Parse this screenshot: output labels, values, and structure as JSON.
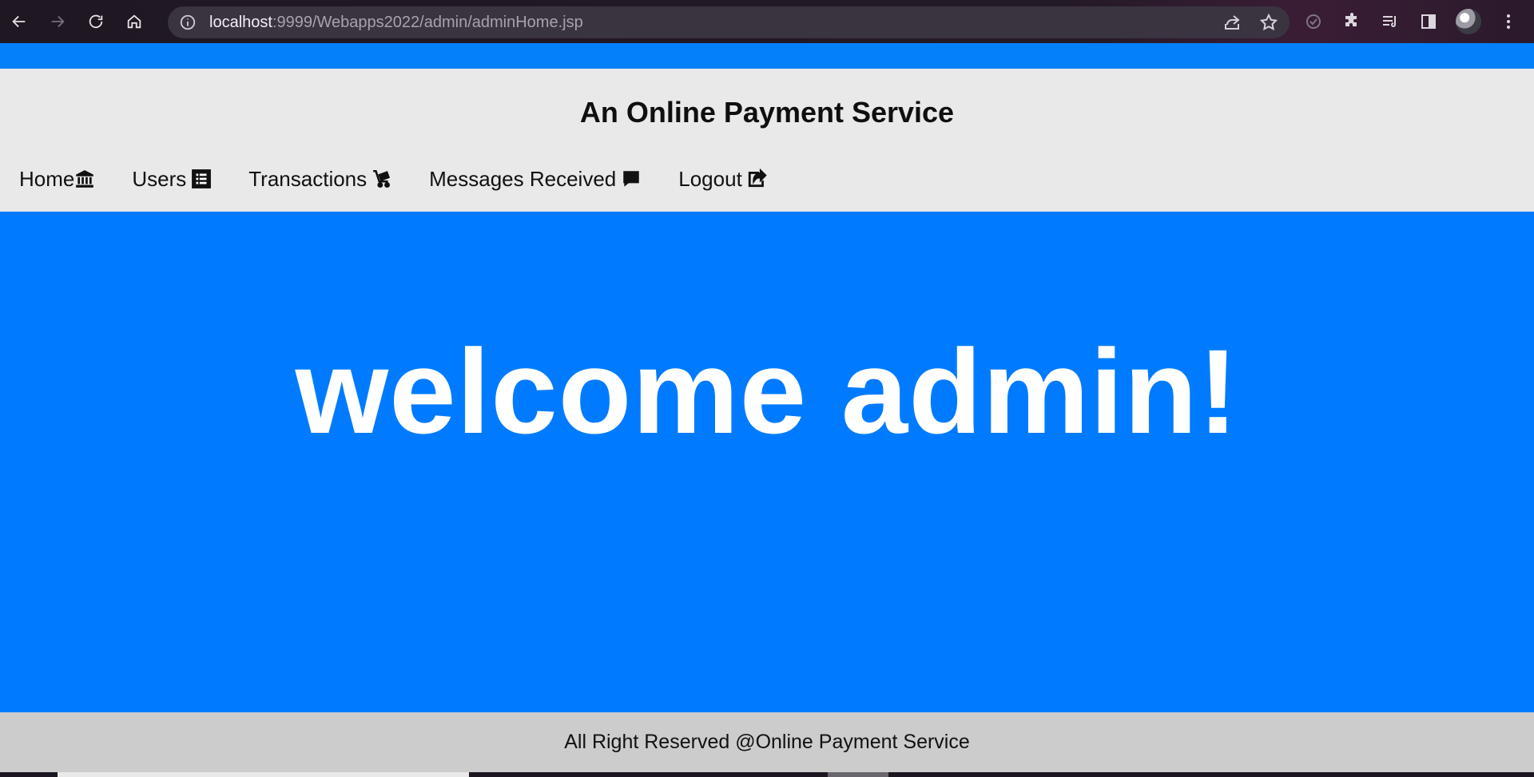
{
  "browser": {
    "url_host": "localhost",
    "url_path": ":9999/Webapps2022/admin/adminHome.jsp"
  },
  "site": {
    "title": "An Online Payment Service"
  },
  "nav": {
    "items": [
      {
        "label": "Home",
        "icon": "bank-icon"
      },
      {
        "label": "Users",
        "icon": "list-icon"
      },
      {
        "label": "Transactions",
        "icon": "cart-icon"
      },
      {
        "label": "Messages Received",
        "icon": "message-icon"
      },
      {
        "label": "Logout",
        "icon": "share-out-icon"
      }
    ]
  },
  "hero": {
    "welcome": "welcome admin!"
  },
  "footer": {
    "text": "All Right Reserved @Online Payment Service"
  },
  "colors": {
    "primary": "#007bff",
    "header_bg": "#e9e9e9",
    "footer_bg": "#cccccc"
  }
}
